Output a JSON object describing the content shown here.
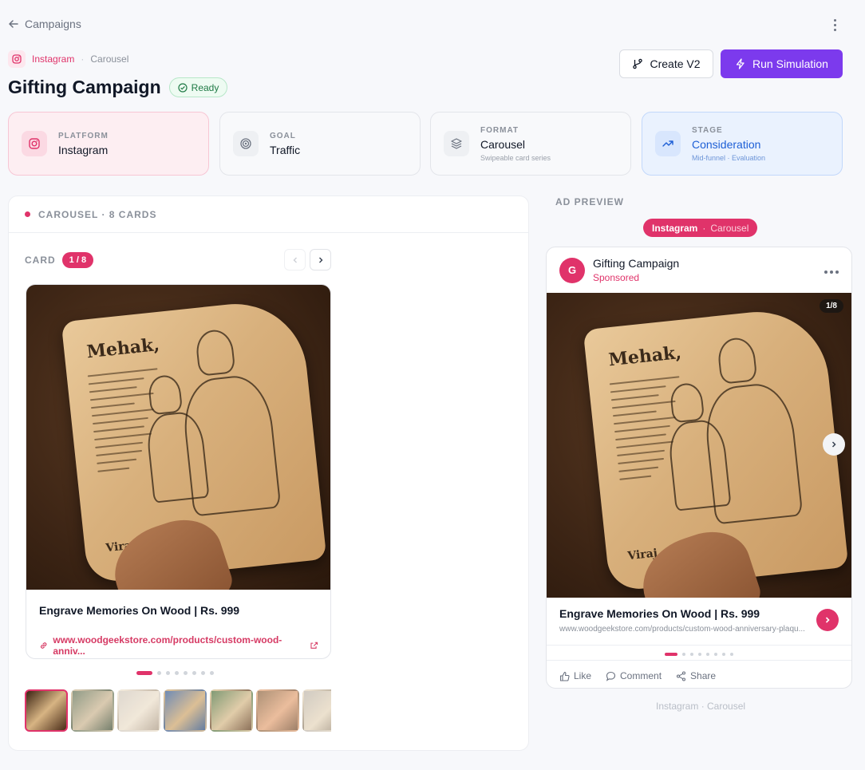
{
  "nav": {
    "back_label": "Campaigns"
  },
  "breadcrumb": {
    "platform": "Instagram",
    "separator": "·",
    "format": "Carousel"
  },
  "campaign": {
    "title": "Gifting Campaign",
    "status": "Ready"
  },
  "actions": {
    "create_v2": "Create V2",
    "run_simulation": "Run Simulation"
  },
  "stats": {
    "platform": {
      "label": "PLATFORM",
      "value": "Instagram"
    },
    "goal": {
      "label": "GOAL",
      "value": "Traffic"
    },
    "format": {
      "label": "FORMAT",
      "value": "Carousel",
      "sub": "Swipeable card series"
    },
    "stage": {
      "label": "STAGE",
      "value": "Consideration",
      "sub": "Mid-funnel · Evaluation"
    }
  },
  "carousel": {
    "header": "CAROUSEL · 8 CARDS",
    "card_label": "CARD",
    "card_counter": "1 / 8",
    "current_card": {
      "headline": "Engrave Memories On Wood | Rs. 999",
      "link": "www.woodgeekstore.com/products/custom-wood-anniv..."
    },
    "total_cards": 8,
    "active_index": 0
  },
  "preview": {
    "section_label": "AD PREVIEW",
    "pill_platform": "Instagram",
    "pill_sep": "·",
    "pill_format": "Carousel",
    "account_initial": "G",
    "account_name": "Gifting Campaign",
    "sponsored": "Sponsored",
    "counter": "1/8",
    "headline": "Engrave Memories On Wood | Rs. 999",
    "url": "www.woodgeekstore.com/products/custom-wood-anniversary-plaqu...",
    "like": "Like",
    "comment": "Comment",
    "share": "Share",
    "caption": "Instagram · Carousel"
  },
  "colors": {
    "accent_pink": "#e0336a",
    "accent_purple": "#7c3aed",
    "stage_blue": "#1d5fd6",
    "ready_green": "#1f7a45"
  }
}
